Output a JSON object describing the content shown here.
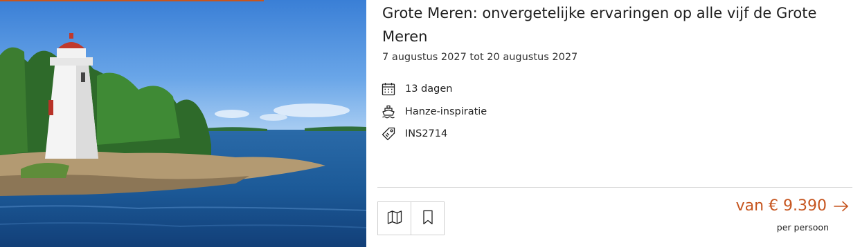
{
  "colors": {
    "accent": "#c6551f",
    "text": "#1f1f1f",
    "border": "#cfcfcf"
  },
  "tour": {
    "title": "Grote Meren: onvergetelijke ervaringen op alle vijf de Grote Meren",
    "dates": "7 augustus 2027 tot 20 augustus 2027",
    "facts": [
      {
        "icon": "calendar-icon",
        "label": "13 dagen"
      },
      {
        "icon": "ship-icon",
        "label": "Hanze-inspiratie"
      },
      {
        "icon": "price-tag-icon",
        "label": "INS2714"
      }
    ]
  },
  "actions": {
    "map_icon": "map-icon",
    "bookmark_icon": "bookmark-icon"
  },
  "price": {
    "text": "van € 9.390",
    "per": "per persoon",
    "arrow_icon": "arrow-right-icon"
  }
}
